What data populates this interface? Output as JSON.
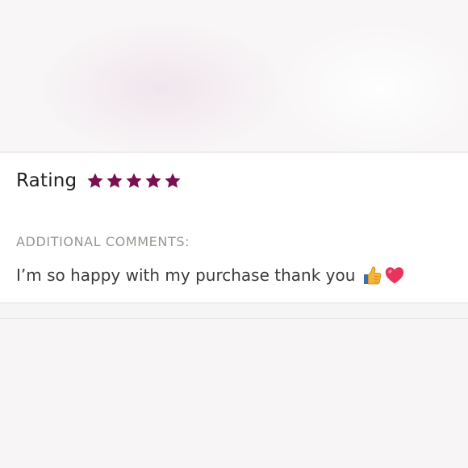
{
  "review": {
    "rating_label": "Rating",
    "rating_value": 5,
    "rating_max": 5,
    "star_color": "#7a0f52",
    "comments_heading": "ADDITIONAL COMMENTS:",
    "comment_text": "I’m so happy with my purchase thank you",
    "comment_emojis": [
      "thumbs-up-icon",
      "heart-icon"
    ]
  }
}
